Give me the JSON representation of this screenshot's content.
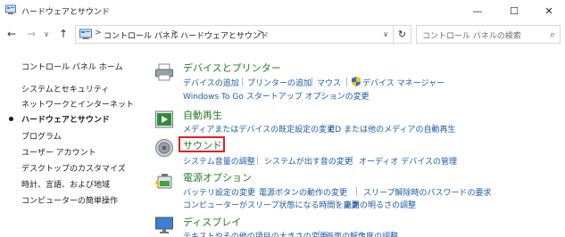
{
  "window": {
    "title": "ハードウェアとサウンド",
    "minimize_glyph": "—",
    "maximize_glyph": "☐",
    "close_glyph": "✕"
  },
  "nav": {
    "back_glyph": "←",
    "forward_glyph": "→",
    "recent_glyph": "∨",
    "up_glyph": "↑",
    "breadcrumb": [
      "コントロール パネル",
      "ハードウェアとサウンド"
    ],
    "separator": ">",
    "dropdown_glyph": "∨",
    "refresh_glyph": "↻",
    "search_placeholder": "コントロール パネルの検索",
    "search_glyph": "⌕"
  },
  "sidebar": {
    "items": [
      {
        "label": "コントロール パネル ホーム"
      },
      {
        "label": "システムとセキュリティ"
      },
      {
        "label": "ネットワークとインターネット"
      },
      {
        "label": "ハードウェアとサウンド",
        "active": true
      },
      {
        "label": "プログラム"
      },
      {
        "label": "ユーザー アカウント"
      },
      {
        "label": "デスクトップのカスタマイズ"
      },
      {
        "label": "時計、言語、および地域"
      },
      {
        "label": "コンピューターの簡単操作"
      }
    ]
  },
  "categories": {
    "devices": {
      "title": "デバイスとプリンター",
      "links": [
        "デバイスの追加",
        "プリンターの追加",
        "マウス",
        "デバイス マネージャー",
        "Windows To Go スタートアップ オプションの変更"
      ]
    },
    "autoplay": {
      "title": "自動再生",
      "links": [
        "メディアまたはデバイスの既定設定の変更",
        "CD または他のメディアの自動再生"
      ]
    },
    "sound": {
      "title": "サウンド",
      "links": [
        "システム音量の調整",
        "システムが出す音の変更",
        "オーディオ デバイスの管理"
      ]
    },
    "power": {
      "title": "電源オプション",
      "links": [
        "バッテリ設定の変更",
        "電源ボタンの動作の変更",
        "スリープ解除時のパスワードの要求",
        "コンピューターがスリープ状態になる時間を変更",
        "画面の明るさの調整"
      ]
    },
    "display": {
      "title": "ディスプレイ",
      "links": [
        "テキストやその他の項目の大きさの変更",
        "画面の解像度の調整"
      ]
    }
  },
  "colors": {
    "category_title": "#2a7b2a",
    "link": "#1e5aa8",
    "highlight": "#e02020"
  }
}
